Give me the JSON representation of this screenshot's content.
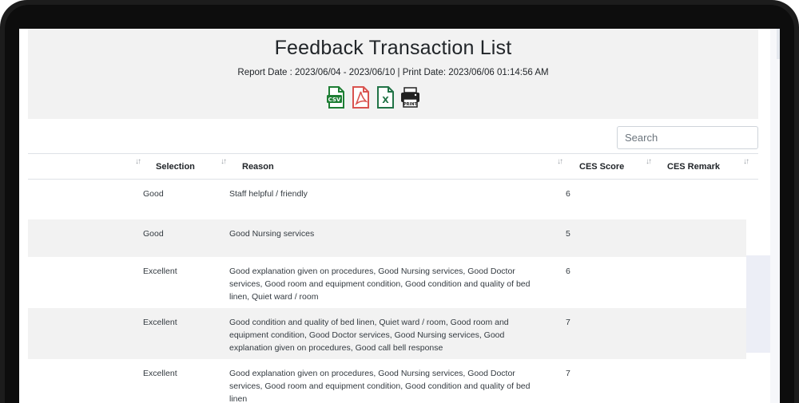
{
  "report": {
    "title": "Feedback Transaction List",
    "meta": "Report Date : 2023/06/04 - 2023/06/10 | Print Date: 2023/06/06 01:14:56 AM"
  },
  "exports": [
    {
      "name": "csv-export-icon",
      "label": "CSV",
      "color": "#1e7e34"
    },
    {
      "name": "pdf-export-icon",
      "color": "#d9534f"
    },
    {
      "name": "excel-export-icon",
      "label": "X",
      "color": "#217346"
    },
    {
      "name": "print-icon",
      "label": "PRINT",
      "color": "#222222"
    }
  ],
  "search": {
    "placeholder": "Search"
  },
  "table": {
    "columns": [
      "Selection",
      "Reason",
      "CES Score",
      "CES Remark"
    ],
    "rows": [
      {
        "selection": "Good",
        "reason": "Staff helpful / friendly",
        "ces_score": "6",
        "ces_remark": ""
      },
      {
        "selection": "Good",
        "reason": "Good Nursing services",
        "ces_score": "5",
        "ces_remark": ""
      },
      {
        "selection": "Excellent",
        "reason": "Good explanation given on procedures, Good Nursing services, Good Doctor services, Good room and equipment condition, Good condition and quality of bed linen, Quiet ward / room",
        "ces_score": "6",
        "ces_remark": ""
      },
      {
        "selection": "Excellent",
        "reason": "Good condition and quality of bed linen, Quiet ward / room, Good room and equipment condition, Good Doctor services, Good Nursing services, Good explanation given on procedures, Good call bell response",
        "ces_score": "7",
        "ces_remark": ""
      },
      {
        "selection": "Excellent",
        "reason": "Good explanation given on procedures, Good Nursing services, Good Doctor services, Good room and equipment condition, Good condition and quality of bed linen",
        "ces_score": "7",
        "ces_remark": ""
      }
    ]
  },
  "colors": {
    "header_bg": "#f2f2f2",
    "alt_row_bg": "#f2f2f2",
    "frame": "#1c1c1c"
  }
}
